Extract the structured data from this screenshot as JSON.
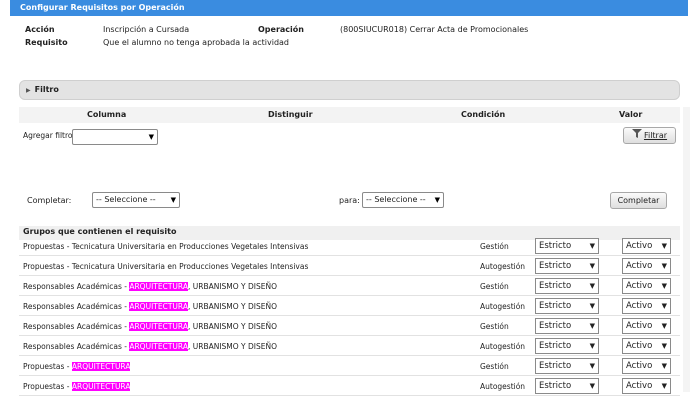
{
  "window": {
    "title": "Configurar Requisitos por Operación"
  },
  "info": {
    "accion_label": "Acción",
    "accion_value": "Inscripción a Cursada",
    "operacion_label": "Operación",
    "operacion_value": "(800SIUCUR018) Cerrar Acta de Promocionales",
    "requisito_label": "Requisito",
    "requisito_value": "Que el alumno no tenga aprobada la actividad"
  },
  "filtro": {
    "title": "Filtro",
    "columns": [
      "Columna",
      "Distinguir",
      "Condición",
      "Valor"
    ],
    "agregar_label": "Agregar filtro",
    "agregar_value": "",
    "filtrar_button": "Filtrar"
  },
  "completar": {
    "label": "Completar:",
    "select_value": "-- Seleccione --",
    "para_label": "para:",
    "para_value": "-- Seleccione --",
    "button": "Completar"
  },
  "grupos": {
    "title": "Grupos que contienen el requisito",
    "rows": [
      {
        "pre": "Propuestas - Tecnicatura Universitaria en Producciones Vegetales Intensivas",
        "hl": "",
        "post": "",
        "tipo": "Gestión",
        "modo": "Estricto",
        "estado": "Activo"
      },
      {
        "pre": "Propuestas - Tecnicatura Universitaria en Producciones Vegetales Intensivas",
        "hl": "",
        "post": "",
        "tipo": "Autogestión",
        "modo": "Estricto",
        "estado": "Activo"
      },
      {
        "pre": "Responsables Académicas - ",
        "hl": "ARQUITECTURA",
        "post": ", URBANISMO Y DISEÑO",
        "tipo": "Gestión",
        "modo": "Estricto",
        "estado": "Activo"
      },
      {
        "pre": "Responsables Académicas - ",
        "hl": "ARQUITECTURA",
        "post": ", URBANISMO Y DISEÑO",
        "tipo": "Autogestión",
        "modo": "Estricto",
        "estado": "Activo"
      },
      {
        "pre": "Responsables Académicas - ",
        "hl": "ARQUITECTURA",
        "post": ", URBANISMO Y DISEÑO",
        "tipo": "Gestión",
        "modo": "Estricto",
        "estado": "Activo"
      },
      {
        "pre": "Responsables Académicas - ",
        "hl": "ARQUITECTURA",
        "post": ", URBANISMO Y DISEÑO",
        "tipo": "Autogestión",
        "modo": "Estricto",
        "estado": "Activo"
      },
      {
        "pre": "Propuestas - ",
        "hl": "ARQUITECTURA",
        "post": "",
        "tipo": "Gestión",
        "modo": "Estricto",
        "estado": "Activo"
      },
      {
        "pre": "Propuestas - ",
        "hl": "ARQUITECTURA",
        "post": "",
        "tipo": "Autogestión",
        "modo": "Estricto",
        "estado": "Activo"
      }
    ]
  },
  "colors": {
    "title_bar": "#3a8ce0",
    "highlight": "#ff00ff"
  }
}
